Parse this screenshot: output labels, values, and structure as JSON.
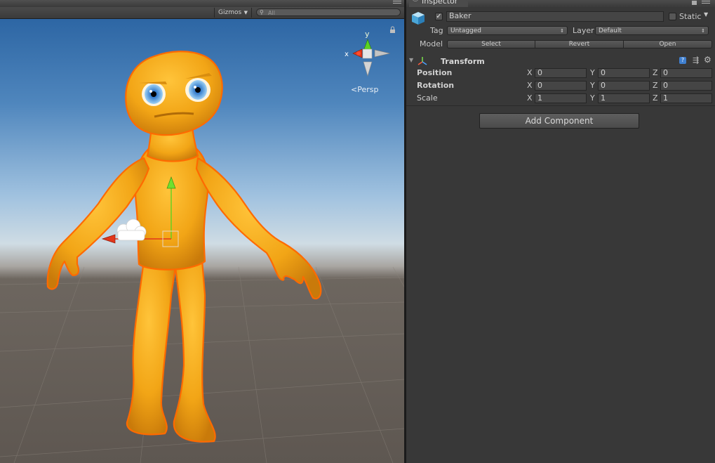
{
  "scene": {
    "gizmos_label": "Gizmos",
    "search_placeholder": "All",
    "persp_label": "Persp",
    "axis_y": "y",
    "axis_x": "x"
  },
  "inspector": {
    "tab_title": "Inspector",
    "object_name": "Baker",
    "object_active": true,
    "static_label": "Static",
    "tag_label": "Tag",
    "tag_value": "Untagged",
    "layer_label": "Layer",
    "layer_value": "Default",
    "model_label": "Model",
    "model_buttons": [
      "Select",
      "Revert",
      "Open"
    ],
    "component_title": "Transform",
    "rows": [
      {
        "name": "Position",
        "x": "0",
        "y": "0",
        "z": "0"
      },
      {
        "name": "Rotation",
        "x": "0",
        "y": "0",
        "z": "0"
      },
      {
        "name": "Scale",
        "x": "1",
        "y": "1",
        "z": "1"
      }
    ],
    "axis_labels": [
      "X",
      "Y",
      "Z"
    ],
    "add_component_label": "Add Component"
  },
  "colors": {
    "character": "#f2a516",
    "outline": "#ff6a00"
  }
}
